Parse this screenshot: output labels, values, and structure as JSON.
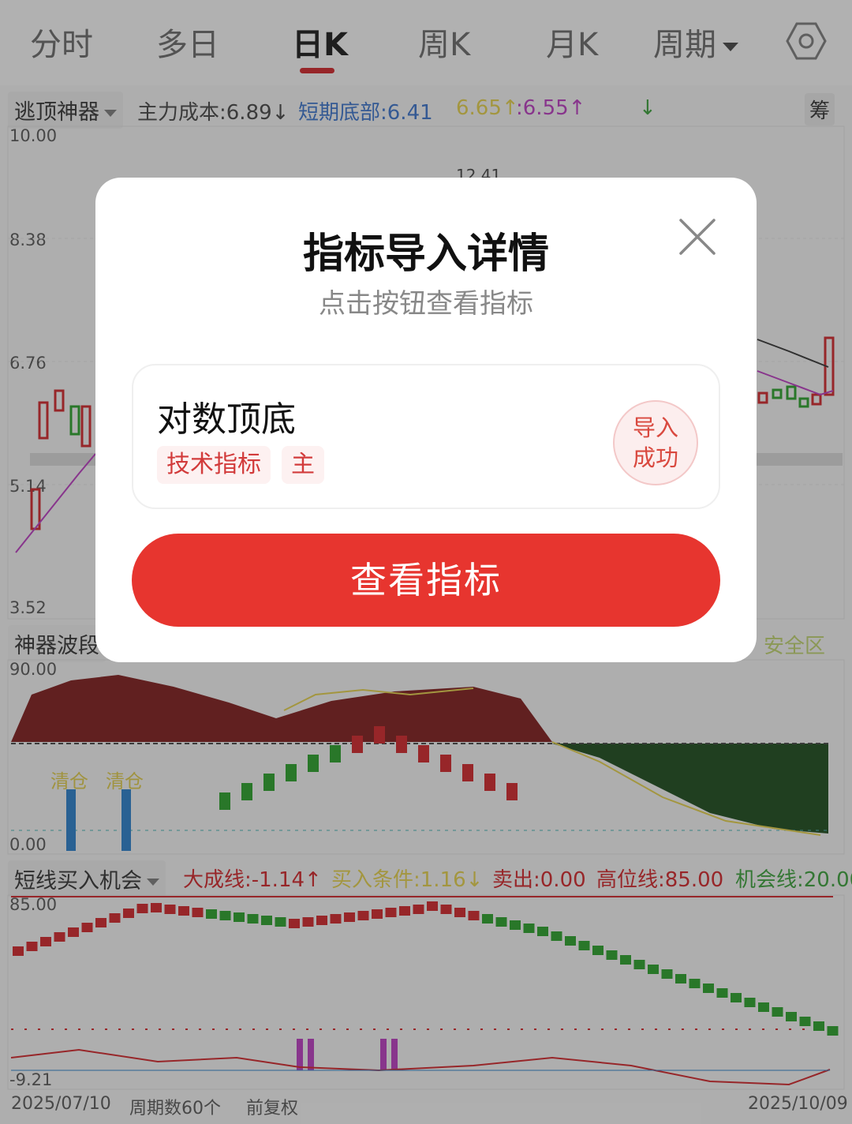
{
  "tabs": {
    "items": [
      {
        "label": "分时"
      },
      {
        "label": "多日"
      },
      {
        "label": "日K",
        "active": true
      },
      {
        "label": "周K"
      },
      {
        "label": "月K"
      },
      {
        "label": "周期"
      }
    ],
    "settings_icon": "settings-hexagon-icon"
  },
  "main_indicator": {
    "name": "逃顶神器",
    "values": [
      {
        "text": "主力成本:6.89↓",
        "color": "#444444"
      },
      {
        "text": "短期底部:6.41",
        "color": "#3a6fc2"
      },
      {
        "text": "6.65↑",
        "color": "#d8c64a"
      },
      {
        "text": ":6.55↑",
        "color": "#b23bb8"
      },
      {
        "text": "↓",
        "color": "#3a9a3a"
      }
    ],
    "right_badge": "筹",
    "axis": [
      "10.00",
      "8.38",
      "6.76",
      "5.14",
      "3.52"
    ],
    "visible_marks": [
      "12.41"
    ]
  },
  "wave_indicator": {
    "name": "神器波段",
    "right_text": "安全区",
    "axis": [
      "90.00",
      "0.00"
    ],
    "labels": [
      "清仓",
      "清仓"
    ]
  },
  "short_indicator": {
    "name": "短线买入机会",
    "values": [
      {
        "text": "大成线:-1.14↑",
        "color": "#c8262a"
      },
      {
        "text": "买入条件:1.16↓",
        "color": "#d8c64a"
      },
      {
        "text": "卖出:0.00",
        "color": "#c8262a"
      },
      {
        "text": "高位线:85.00",
        "color": "#c8262a"
      },
      {
        "text": "机会线:20.00",
        "color": "#3a9a3a"
      }
    ],
    "axis": [
      "85.00",
      "-9.21"
    ]
  },
  "bottom_bar": {
    "start_date": "2025/07/10",
    "period_count": "周期数60个",
    "adjust": "前复权",
    "end_date": "2025/10/09"
  },
  "dialog": {
    "title": "指标导入详情",
    "subtitle": "点击按钮查看指标",
    "card": {
      "name": "对数顶底",
      "tags": [
        "技术指标",
        "主"
      ],
      "status_line1": "导入",
      "status_line2": "成功"
    },
    "button_label": "查看指标",
    "close_icon": "close-x-icon"
  },
  "colors": {
    "accent_red": "#e7352f",
    "up_red": "#c8262a",
    "down_green": "#2a9a2a"
  }
}
